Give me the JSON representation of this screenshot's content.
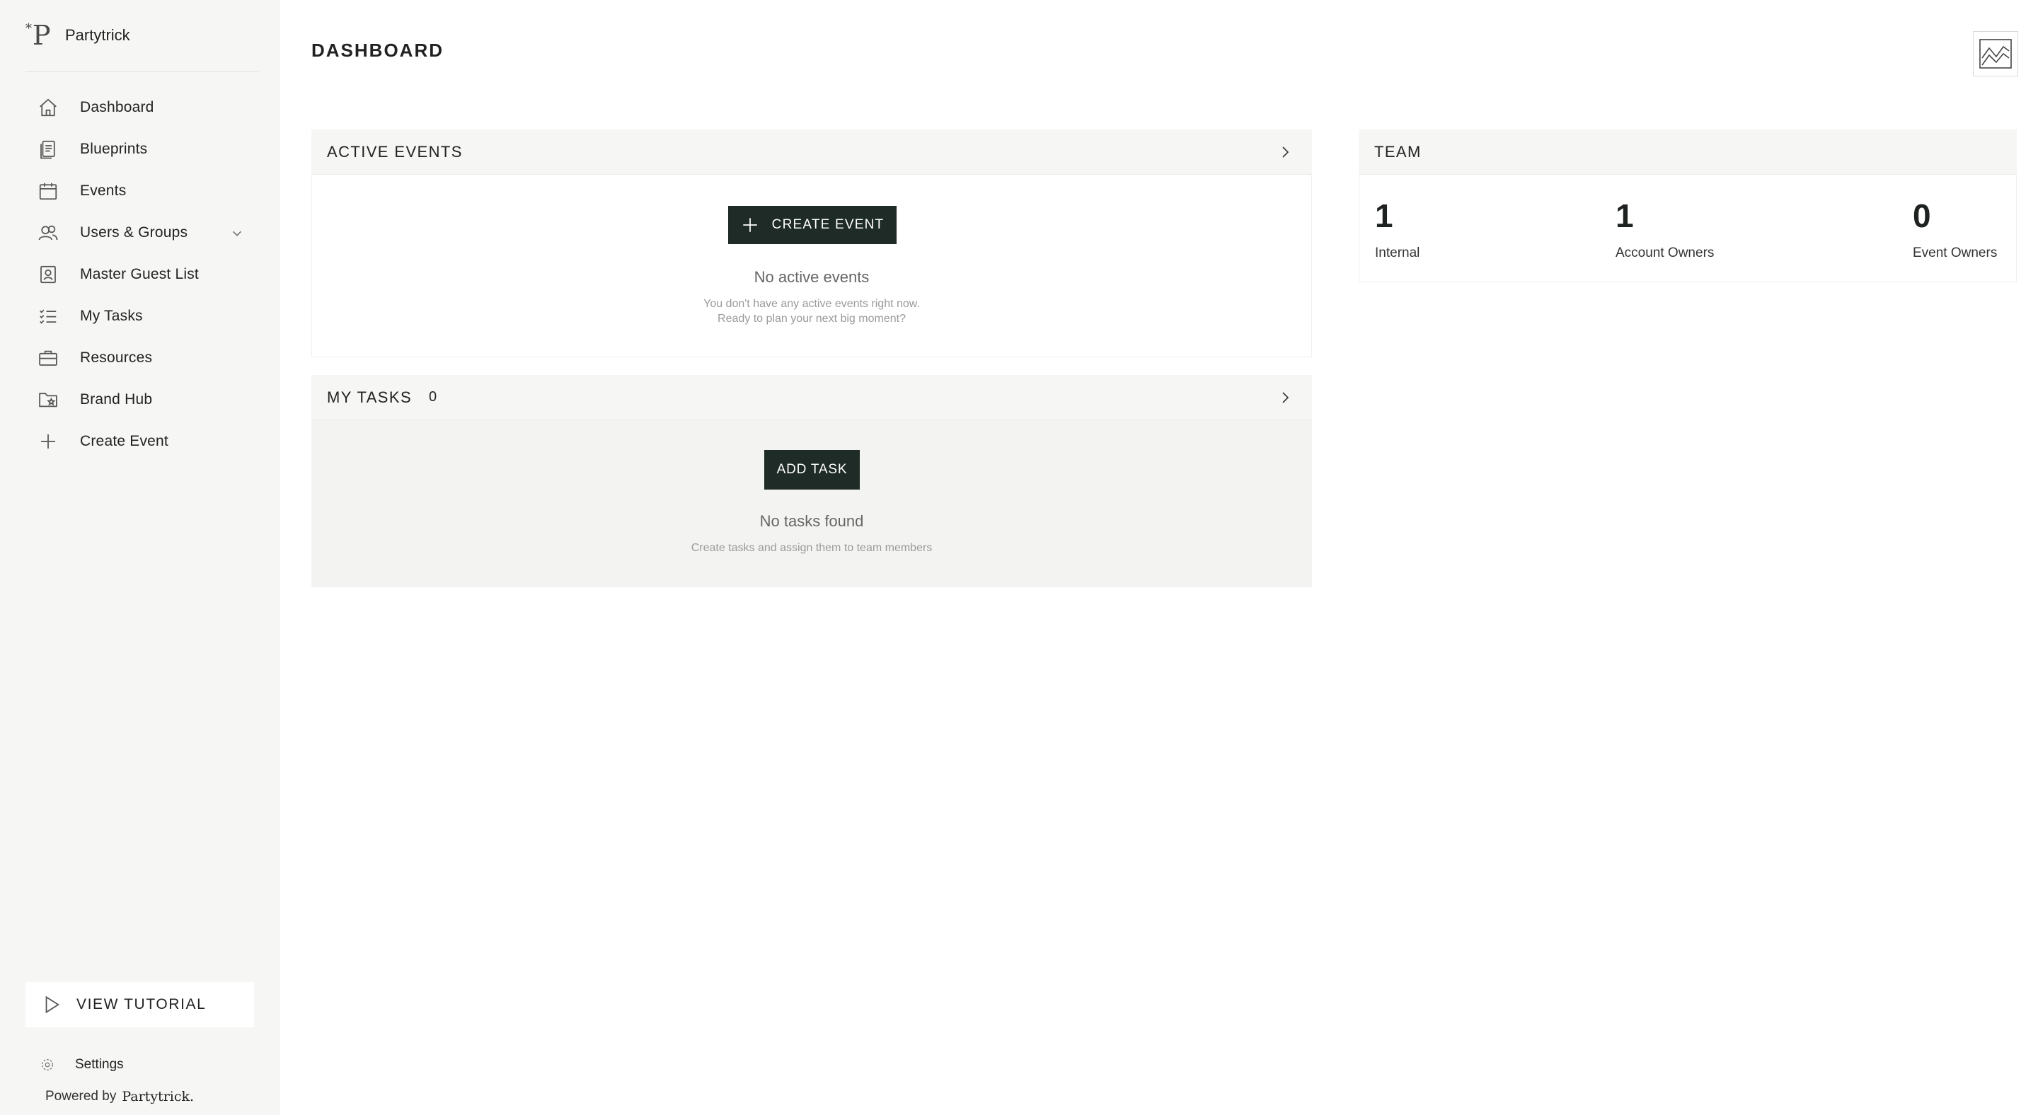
{
  "sidebar": {
    "brand": {
      "logo_mark": "P",
      "logo_sup": "*",
      "name": "Partytrick"
    },
    "items": [
      {
        "label": "Dashboard",
        "icon": "home-icon"
      },
      {
        "label": "Blueprints",
        "icon": "blueprint-icon"
      },
      {
        "label": "Events",
        "icon": "calendar-icon"
      },
      {
        "label": "Users & Groups",
        "icon": "users-icon"
      },
      {
        "label": "Master Guest List",
        "icon": "contact-book-icon"
      },
      {
        "label": "My Tasks",
        "icon": "checklist-icon"
      },
      {
        "label": "Resources",
        "icon": "briefcase-icon"
      },
      {
        "label": "Brand Hub",
        "icon": "folder-star-icon"
      },
      {
        "label": "Create Event",
        "icon": "plus-icon"
      }
    ],
    "tutorial_label": "VIEW TUTORIAL",
    "settings_label": "Settings",
    "powered_by": "Powered by",
    "powered_brand": "Partytrick."
  },
  "header": {
    "title": "DASHBOARD",
    "report_icon": "chart-icon"
  },
  "active_events": {
    "title": "ACTIVE EVENTS",
    "create_label": "CREATE EVENT",
    "empty_title": "No active events",
    "empty_line1": "You don't have any active events right now.",
    "empty_line2": "Ready to plan your next big moment?"
  },
  "my_tasks": {
    "title": "MY TASKS",
    "count": "0",
    "add_label": "ADD TASK",
    "empty_title": "No tasks found",
    "empty_sub": "Create tasks and assign them to team members"
  },
  "team": {
    "title": "TEAM",
    "stats": [
      {
        "value": "1",
        "label": "Internal"
      },
      {
        "value": "1",
        "label": "Account Owners"
      },
      {
        "value": "0",
        "label": "Event Owners"
      }
    ]
  },
  "colors": {
    "sidebar_bg": "#f6f6f4",
    "primary_button": "#1f2b26",
    "panel_header_bg": "#f6f6f4"
  }
}
